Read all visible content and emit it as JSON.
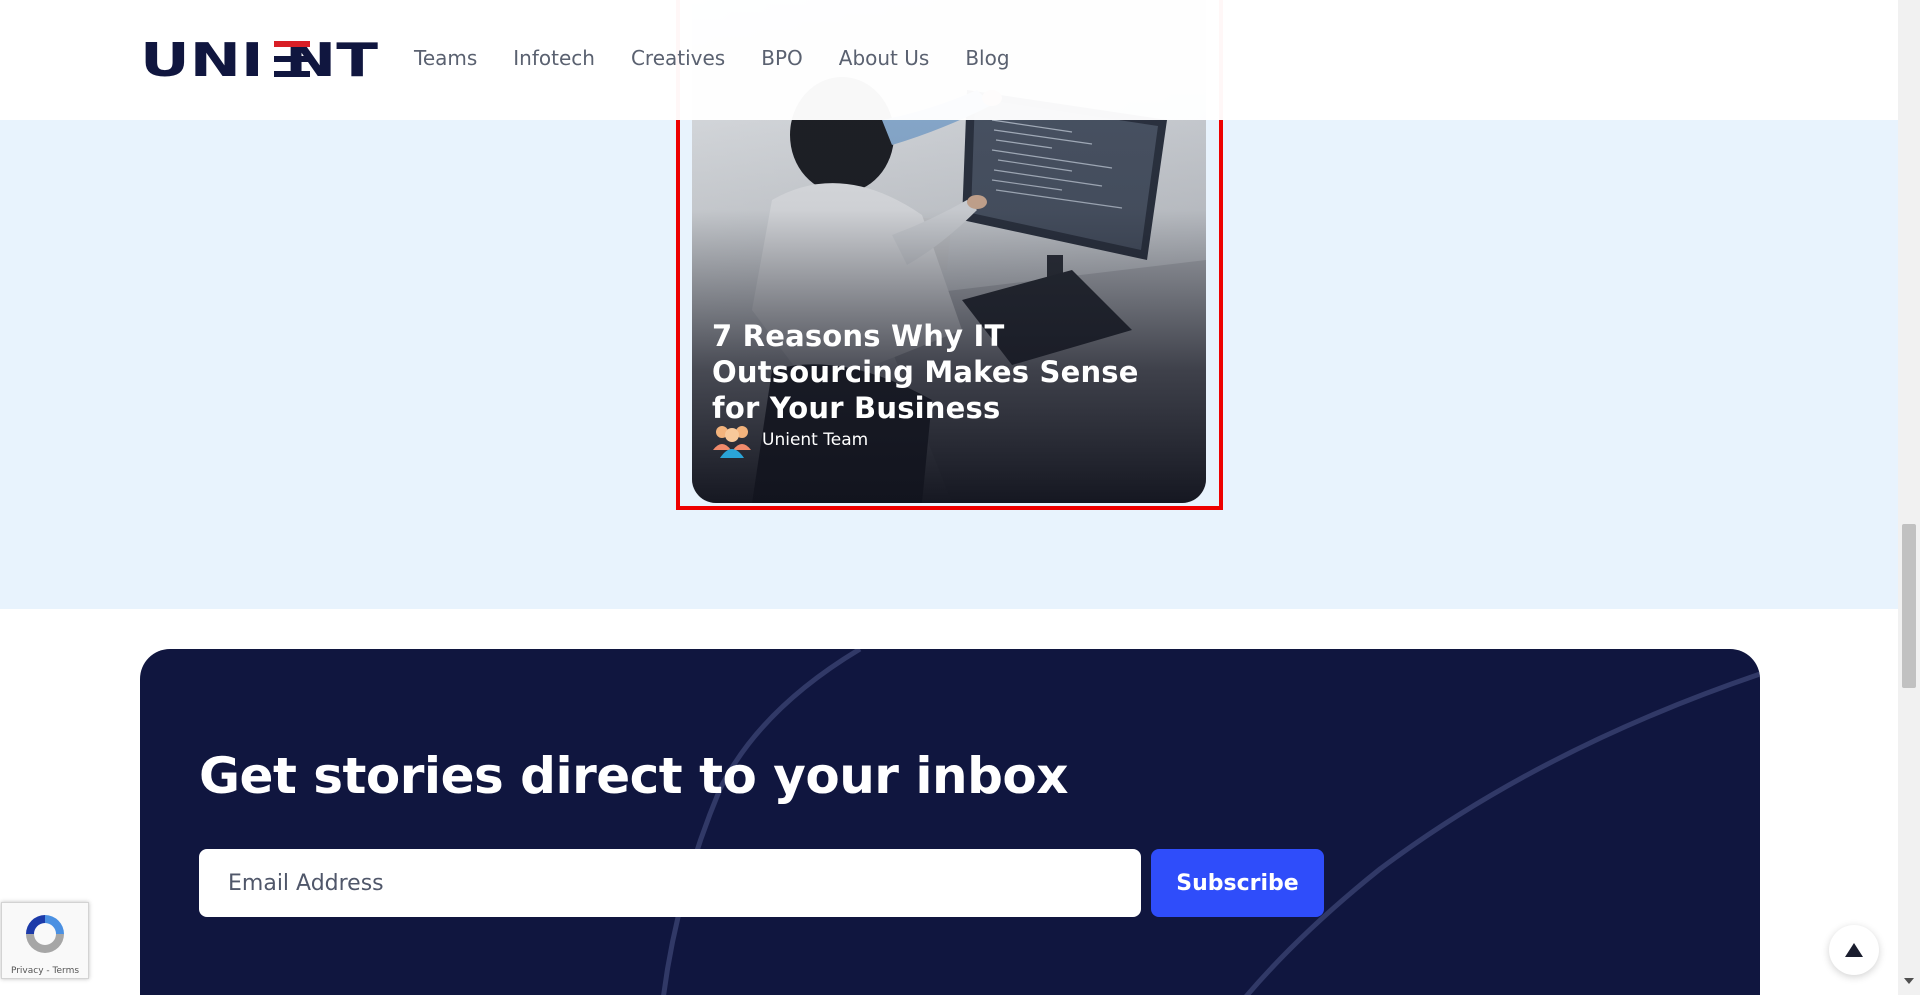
{
  "header": {
    "logo_text": "UNIENT",
    "nav": [
      "Teams",
      "Infotech",
      "Creatives",
      "BPO",
      "About Us",
      "Blog"
    ]
  },
  "blog_card": {
    "title": "7 Reasons Why IT Outsourcing Makes Sense for Your Business",
    "author": "Unient Team"
  },
  "newsletter": {
    "title": "Get stories direct to your inbox",
    "email_placeholder": "Email Address",
    "subscribe_label": "Subscribe"
  },
  "recaptcha": {
    "privacy": "Privacy",
    "separator": " - ",
    "terms": "Terms"
  },
  "colors": {
    "brand_navy": "#10163f",
    "brand_red": "#d81f26",
    "accent_blue": "#2f4dfa",
    "band_blue": "#e8f3fd",
    "highlight_red": "#ee0000"
  }
}
